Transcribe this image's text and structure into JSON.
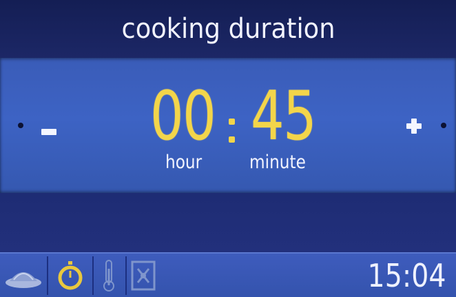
{
  "screen": {
    "title": "cooking duration"
  },
  "timer": {
    "hours": "00",
    "minutes": "45",
    "hour_label": "hour",
    "minute_label": "minute"
  },
  "controls": {
    "decrease_icon": "minus-icon",
    "increase_icon": "plus-icon"
  },
  "status_bar": {
    "icons": [
      "dish-icon",
      "timer-icon",
      "thermometer-icon",
      "heating-mode-icon"
    ],
    "clock": "15:04"
  },
  "colors": {
    "digit_yellow": "#f3d54a",
    "band_blue": "#3d63c4",
    "dark_navy": "#11194a"
  }
}
